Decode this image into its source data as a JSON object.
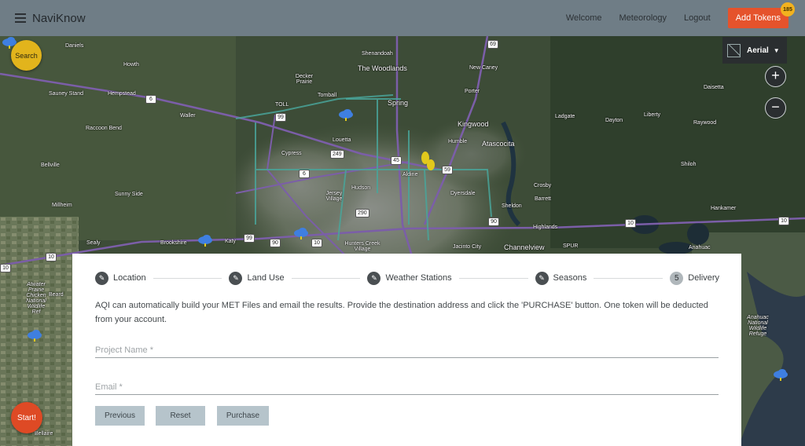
{
  "app": {
    "brand": "NaviKnow",
    "nav": {
      "welcome": "Welcome",
      "meteorology": "Meteorology",
      "logout": "Logout",
      "add_tokens": "Add Tokens",
      "token_count": "185"
    }
  },
  "map": {
    "search_label": "Search",
    "start_label": "Start!",
    "basemap_label": "Aerial",
    "zoom_in": "+",
    "zoom_out": "−",
    "labels": [
      "Daniels",
      "Howth",
      "Shenandoah",
      "The Woodlands",
      "New Caney",
      "Sauney Stand",
      "Hempstead",
      "Decker Prairie",
      "Tomball",
      "Porter",
      "Waller",
      "Spring",
      "Kingwood",
      "Ladgate",
      "Dayton",
      "Liberty",
      "Daisetta",
      "Raywood",
      "Raccoon Bend",
      "Humble",
      "Atascocita",
      "Louetta",
      "Cypress",
      "Bellville",
      "Aldine",
      "Crosby",
      "Shiloh",
      "Sunny Side",
      "Jersey Village",
      "Hudson",
      "Dyersdale",
      "Barrett",
      "Millheim",
      "Sheldon",
      "Hankamer",
      "Sealy",
      "Brookshire",
      "Katy",
      "Hunters Creek Village",
      "Jacinto City",
      "Channelview",
      "Highlands",
      "Anahuac",
      "Atwater Prairie Chicken National Wildlife Ref",
      "Beard",
      "Anahuac National Wildlife Refuge",
      "Bellaire",
      "TOLL",
      "SPUR"
    ],
    "shields": [
      "69",
      "6",
      "99",
      "249",
      "45",
      "59",
      "6",
      "290",
      "90",
      "99",
      "90",
      "10",
      "10",
      "10",
      "10",
      "10"
    ]
  },
  "wizard": {
    "steps": [
      {
        "label": "Location",
        "icon": "pencil-icon"
      },
      {
        "label": "Land Use",
        "icon": "pencil-icon"
      },
      {
        "label": "Weather Stations",
        "icon": "pencil-icon"
      },
      {
        "label": "Seasons",
        "icon": "pencil-icon"
      },
      {
        "label": "Delivery",
        "number": "5"
      }
    ],
    "description": "AQI can automatically build your MET Files and email the results. Provide the destination address and click the 'PURCHASE' button. One token will be deducted from your account.",
    "fields": {
      "project_name_placeholder": "Project Name *",
      "project_name_value": "",
      "email_placeholder": "Email *",
      "email_value": ""
    },
    "buttons": {
      "previous": "Previous",
      "reset": "Reset",
      "purchase": "Purchase"
    }
  },
  "colors": {
    "header": "#6f7d86",
    "accent_orange": "#e5532c",
    "search_yellow": "#e2b41c",
    "weather_icon_blue": "#3f7fe0",
    "button_gray": "#b6c4cb"
  }
}
